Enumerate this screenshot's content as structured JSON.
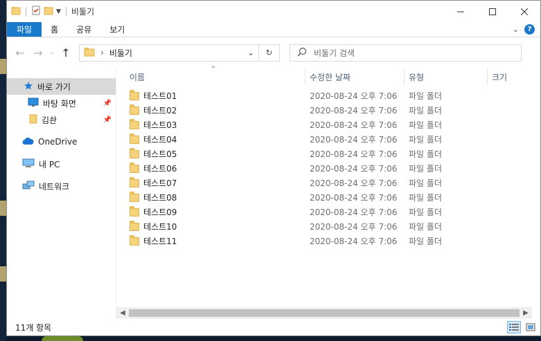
{
  "window": {
    "title": "비둘기"
  },
  "ribbon": {
    "tabs": [
      {
        "label": "파일"
      },
      {
        "label": "홈"
      },
      {
        "label": "공유"
      },
      {
        "label": "보기"
      }
    ]
  },
  "address": {
    "path": "비둘기"
  },
  "search": {
    "placeholder": "비둘기 검색"
  },
  "sidebar": {
    "items": [
      {
        "label": "바로 가기",
        "icon": "star-icon"
      },
      {
        "label": "바탕 화면",
        "icon": "desktop-icon",
        "pinned": true
      },
      {
        "label": "김솬",
        "icon": "folder-icon",
        "pinned": true
      },
      {
        "label": "OneDrive",
        "icon": "cloud-icon"
      },
      {
        "label": "내 PC",
        "icon": "computer-icon"
      },
      {
        "label": "네트워크",
        "icon": "network-icon"
      }
    ]
  },
  "columns": {
    "name": "이름",
    "date": "수정한 날짜",
    "type": "유형",
    "size": "크기"
  },
  "files": [
    {
      "name": "테스트01",
      "date": "2020-08-24 오후 7:06",
      "type": "파일 폴더"
    },
    {
      "name": "테스트02",
      "date": "2020-08-24 오후 7:06",
      "type": "파일 폴더"
    },
    {
      "name": "테스트03",
      "date": "2020-08-24 오후 7:06",
      "type": "파일 폴더"
    },
    {
      "name": "테스트04",
      "date": "2020-08-24 오후 7:06",
      "type": "파일 폴더"
    },
    {
      "name": "테스트05",
      "date": "2020-08-24 오후 7:06",
      "type": "파일 폴더"
    },
    {
      "name": "테스트06",
      "date": "2020-08-24 오후 7:06",
      "type": "파일 폴더"
    },
    {
      "name": "테스트07",
      "date": "2020-08-24 오후 7:06",
      "type": "파일 폴더"
    },
    {
      "name": "테스트08",
      "date": "2020-08-24 오후 7:06",
      "type": "파일 폴더"
    },
    {
      "name": "테스트09",
      "date": "2020-08-24 오후 7:06",
      "type": "파일 폴더"
    },
    {
      "name": "테스트10",
      "date": "2020-08-24 오후 7:06",
      "type": "파일 폴더"
    },
    {
      "name": "테스트11",
      "date": "2020-08-24 오후 7:06",
      "type": "파일 폴더"
    }
  ],
  "status": {
    "count": "11개 항목"
  },
  "colors": {
    "accent": "#1979ca",
    "folder": "#f6d27a",
    "selected": "#d9d9d9"
  }
}
